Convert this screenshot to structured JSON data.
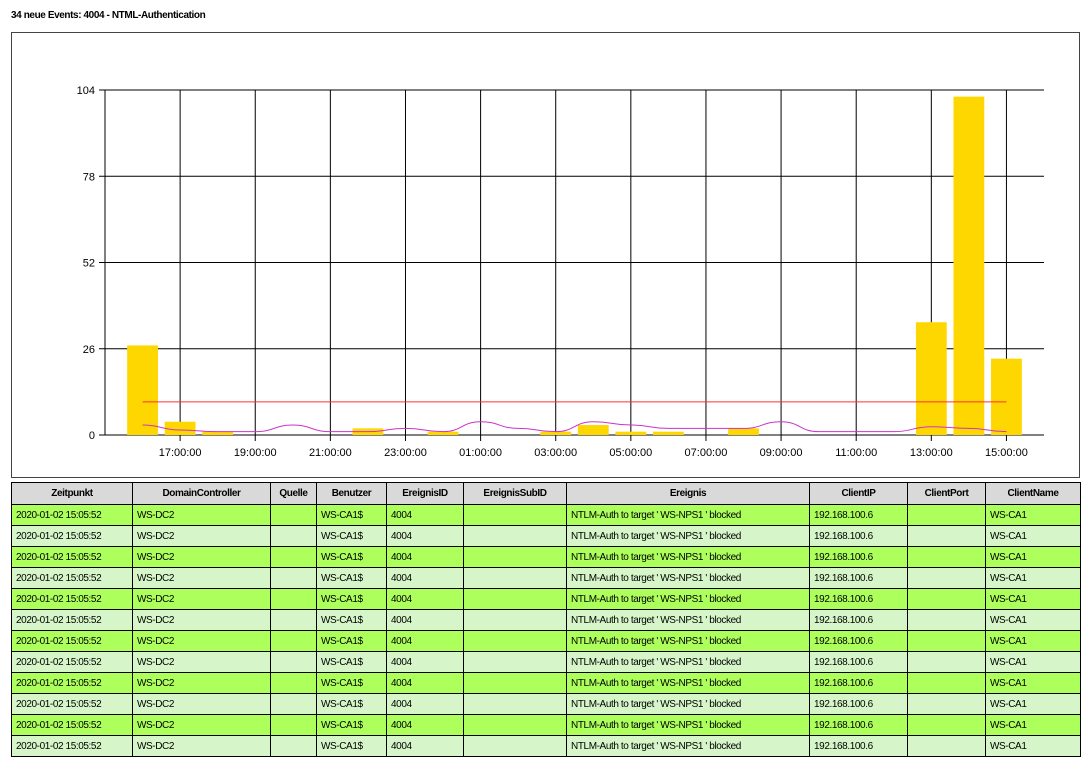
{
  "page": {
    "title": "34 neue Events: 4004 - NTML-Authentication"
  },
  "chart_data": {
    "type": "bar",
    "title": "",
    "xlabel": "",
    "ylabel": "",
    "ylim": [
      0,
      104
    ],
    "y_ticks": [
      0,
      26,
      52,
      78,
      104
    ],
    "x_tick_labels": [
      "17:00:00",
      "19:00:00",
      "21:00:00",
      "23:00:00",
      "01:00:00",
      "03:00:00",
      "05:00:00",
      "07:00:00",
      "09:00:00",
      "11:00:00",
      "13:00:00",
      "15:00:00"
    ],
    "bar_color": "#ffd700",
    "grid": true,
    "series": [
      {
        "type": "bar",
        "hours": [
          16,
          17,
          18,
          22,
          24,
          27,
          28,
          29,
          30,
          32,
          37,
          38,
          39
        ],
        "values": [
          27,
          4,
          1,
          2,
          1,
          1,
          3,
          1,
          1,
          2,
          34,
          102,
          23
        ]
      },
      {
        "type": "line",
        "color": "#ff3030",
        "hours": [
          16,
          39
        ],
        "values": [
          10,
          10
        ]
      },
      {
        "type": "line",
        "color": "#cc33cc",
        "hours": [
          16,
          17,
          18,
          19,
          20,
          21,
          22,
          23,
          24,
          25,
          26,
          27,
          28,
          29,
          30,
          31,
          32,
          33,
          34,
          35,
          36,
          37,
          38,
          39
        ],
        "values": [
          3,
          1.5,
          1,
          1,
          3,
          1,
          1,
          2,
          1,
          4,
          2,
          1,
          4,
          3,
          2,
          2,
          2,
          4,
          1,
          1,
          1,
          2.5,
          2,
          1
        ]
      }
    ]
  },
  "table": {
    "columns": [
      "Zeitpunkt",
      "DomainController",
      "Quelle",
      "Benutzer",
      "EreignisID",
      "EreignisSubID",
      "Ereignis",
      "ClientIP",
      "ClientPort",
      "ClientName"
    ],
    "rows": [
      [
        "2020-01-02 15:05:52",
        "WS-DC2",
        "",
        "WS-CA1$",
        "4004",
        "",
        "NTLM-Auth to target ' WS-NPS1 ' blocked",
        "192.168.100.6",
        "",
        "WS-CA1"
      ],
      [
        "2020-01-02 15:05:52",
        "WS-DC2",
        "",
        "WS-CA1$",
        "4004",
        "",
        "NTLM-Auth to target ' WS-NPS1 ' blocked",
        "192.168.100.6",
        "",
        "WS-CA1"
      ],
      [
        "2020-01-02 15:05:52",
        "WS-DC2",
        "",
        "WS-CA1$",
        "4004",
        "",
        "NTLM-Auth to target ' WS-NPS1 ' blocked",
        "192.168.100.6",
        "",
        "WS-CA1"
      ],
      [
        "2020-01-02 15:05:52",
        "WS-DC2",
        "",
        "WS-CA1$",
        "4004",
        "",
        "NTLM-Auth to target ' WS-NPS1 ' blocked",
        "192.168.100.6",
        "",
        "WS-CA1"
      ],
      [
        "2020-01-02 15:05:52",
        "WS-DC2",
        "",
        "WS-CA1$",
        "4004",
        "",
        "NTLM-Auth to target ' WS-NPS1 ' blocked",
        "192.168.100.6",
        "",
        "WS-CA1"
      ],
      [
        "2020-01-02 15:05:52",
        "WS-DC2",
        "",
        "WS-CA1$",
        "4004",
        "",
        "NTLM-Auth to target ' WS-NPS1 ' blocked",
        "192.168.100.6",
        "",
        "WS-CA1"
      ],
      [
        "2020-01-02 15:05:52",
        "WS-DC2",
        "",
        "WS-CA1$",
        "4004",
        "",
        "NTLM-Auth to target ' WS-NPS1 ' blocked",
        "192.168.100.6",
        "",
        "WS-CA1"
      ],
      [
        "2020-01-02 15:05:52",
        "WS-DC2",
        "",
        "WS-CA1$",
        "4004",
        "",
        "NTLM-Auth to target ' WS-NPS1 ' blocked",
        "192.168.100.6",
        "",
        "WS-CA1"
      ],
      [
        "2020-01-02 15:05:52",
        "WS-DC2",
        "",
        "WS-CA1$",
        "4004",
        "",
        "NTLM-Auth to target ' WS-NPS1 ' blocked",
        "192.168.100.6",
        "",
        "WS-CA1"
      ],
      [
        "2020-01-02 15:05:52",
        "WS-DC2",
        "",
        "WS-CA1$",
        "4004",
        "",
        "NTLM-Auth to target ' WS-NPS1 ' blocked",
        "192.168.100.6",
        "",
        "WS-CA1"
      ],
      [
        "2020-01-02 15:05:52",
        "WS-DC2",
        "",
        "WS-CA1$",
        "4004",
        "",
        "NTLM-Auth to target ' WS-NPS1 ' blocked",
        "192.168.100.6",
        "",
        "WS-CA1"
      ],
      [
        "2020-01-02 15:05:52",
        "WS-DC2",
        "",
        "WS-CA1$",
        "4004",
        "",
        "NTLM-Auth to target ' WS-NPS1 ' blocked",
        "192.168.100.6",
        "",
        "WS-CA1"
      ]
    ]
  }
}
